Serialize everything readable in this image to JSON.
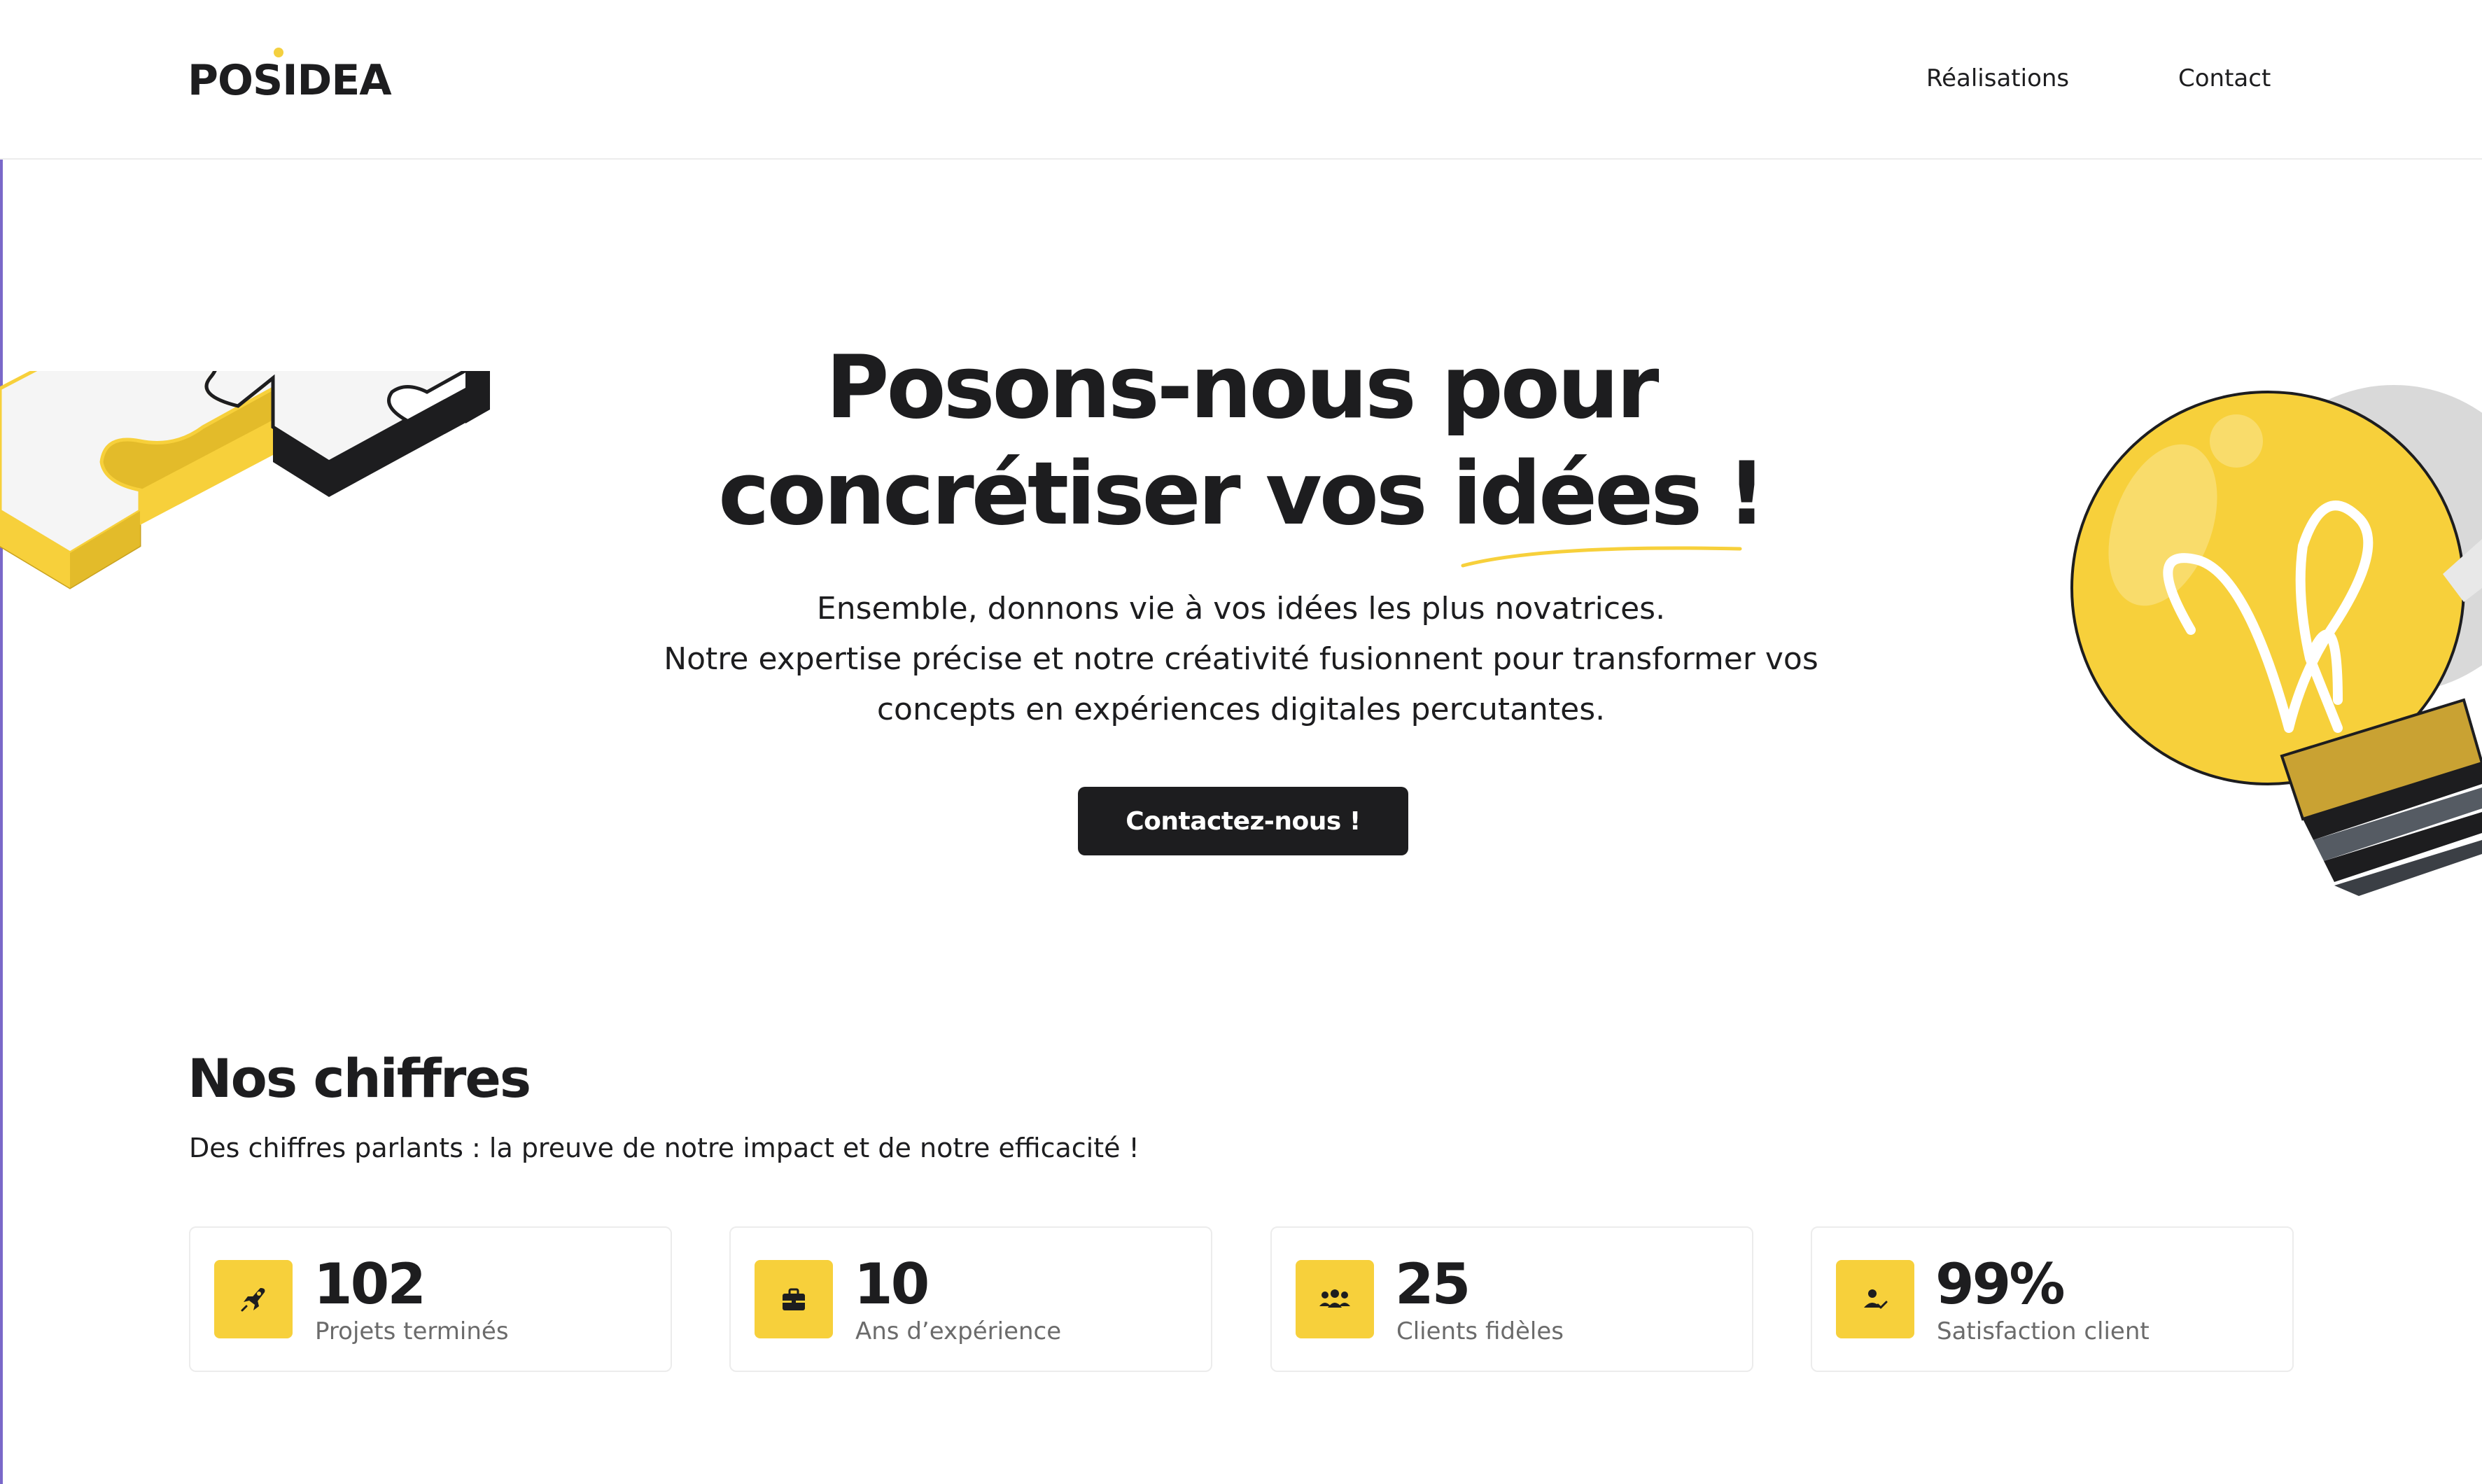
{
  "header": {
    "logo_text": "POSIDEA",
    "nav": {
      "realisations": "Réalisations",
      "contact": "Contact"
    }
  },
  "hero": {
    "title_line1": "Posons-nous pour",
    "title_line2": "concrétiser vos idées !",
    "subtitle_line1": "Ensemble, donnons vie à vos idées les plus novatrices.",
    "subtitle_line2": "Notre expertise précise et notre créativité fusionnent pour transformer vos",
    "subtitle_line3": "concepts en expériences digitales percutantes.",
    "cta_label": "Contactez-nous !"
  },
  "stats": {
    "title": "Nos chiffres",
    "description": "Des chiffres parlants : la preuve de notre impact et de notre efficacité !",
    "items": [
      {
        "value": "102",
        "label": "Projets terminés",
        "icon": "rocket-icon"
      },
      {
        "value": "10",
        "label": "Ans d’expérience",
        "icon": "briefcase-icon"
      },
      {
        "value": "25",
        "label": "Clients fidèles",
        "icon": "group-icon"
      },
      {
        "value": "99%",
        "label": "Satisfaction client",
        "icon": "user-check-icon"
      }
    ]
  },
  "colors": {
    "accent_yellow": "#f7d03b",
    "dark": "#1d1d1f",
    "muted_text": "#6b6b6b",
    "border": "#ececec"
  }
}
